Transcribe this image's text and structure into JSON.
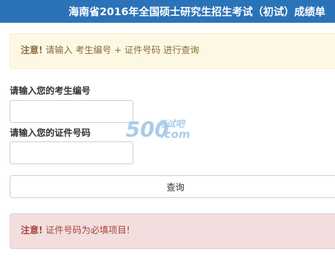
{
  "header": {
    "title": "海南省2016年全国硕士研究生招生考试（初试）成绩单"
  },
  "notice": {
    "prefix": "注意!",
    "text": "请输入 考生编号 + 证件号码 进行查询"
  },
  "form": {
    "exam_id_label": "请输入您的考生编号",
    "exam_id_value": "",
    "id_number_label": "请输入您的证件号码",
    "id_number_value": "",
    "submit_label": "查询"
  },
  "error": {
    "prefix": "注意!",
    "text": "证件号码为必填项目!"
  },
  "watermark": {
    "number": "500",
    "line1": "考试吧",
    "line2": ".com"
  },
  "colors": {
    "header_bg": "#2a73b8",
    "warning_bg": "#fcf8e3",
    "warning_text": "#8a6d3b",
    "danger_bg": "#f2dede",
    "danger_text": "#a94442"
  }
}
